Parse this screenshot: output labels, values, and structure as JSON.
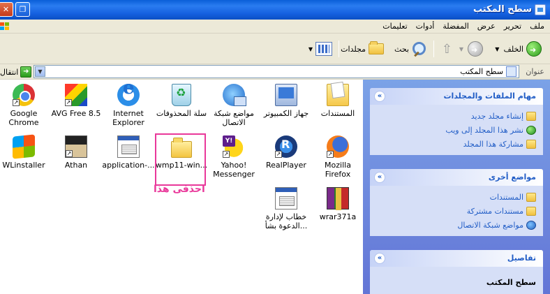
{
  "window": {
    "title": "سطح المكتب",
    "close_glyph": "✕",
    "restore_glyph": "❐"
  },
  "menu": [
    "ملف",
    "تحرير",
    "عرض",
    "المفضلة",
    "أدوات",
    "تعليمات"
  ],
  "toolbar": {
    "back_label": "الخلف",
    "search_label": "بحث",
    "folders_label": "مجلدات"
  },
  "address": {
    "label": "عنوان",
    "value": "سطح المكتب",
    "go_label": "انتقال"
  },
  "panels": {
    "tasks": {
      "title": "مهام الملفات والمجلدات",
      "items": [
        "إنشاء مجلد جديد",
        "نشر هذا المجلد إلى ويب",
        "مشاركة هذا المجلد"
      ]
    },
    "other": {
      "title": "مواضع أخرى",
      "items": [
        "المستندات",
        "مستندات مشتركة",
        "مواضع شبكة الاتصال"
      ]
    },
    "details": {
      "title": "تفاصيل",
      "text": "سطح المكتب"
    }
  },
  "icons": [
    {
      "label": "Google Chrome",
      "icon": "chrome-icon"
    },
    {
      "label": "AVG Free 8.5",
      "icon": "avg-icon"
    },
    {
      "label": "Internet Explorer",
      "icon": "ie-icon"
    },
    {
      "label": "سلة المحذوفات",
      "icon": "recycle-bin-icon"
    },
    {
      "label": "مواضع شبكة الاتصال",
      "icon": "network-icon"
    },
    {
      "label": "جهاز الكمبيوتر",
      "icon": "computer-icon"
    },
    {
      "label": "المستندات",
      "icon": "documents-icon"
    },
    {
      "label": "WLinstaller",
      "icon": "windows-icon"
    },
    {
      "label": "Athan",
      "icon": "athan-icon"
    },
    {
      "label": "application-...",
      "icon": "application-icon"
    },
    {
      "label": "wmp11-win...",
      "icon": "folder-icon"
    },
    {
      "label": "Yahoo! Messenger",
      "icon": "yahoo-icon"
    },
    {
      "label": "RealPlayer",
      "icon": "realplayer-icon"
    },
    {
      "label": "Mozilla Firefox",
      "icon": "firefox-icon"
    },
    {
      "label": "خطاب لإدارة الدعوة بشأ...",
      "icon": "document-icon"
    },
    {
      "label": "wrar371a",
      "icon": "winrar-icon"
    }
  ],
  "annotation": "احذفى هذا",
  "colors": {
    "titlebar": "#0a5fd8",
    "taskpane": "#6375d6",
    "link": "#215dc6",
    "highlight": "#e9389a"
  }
}
